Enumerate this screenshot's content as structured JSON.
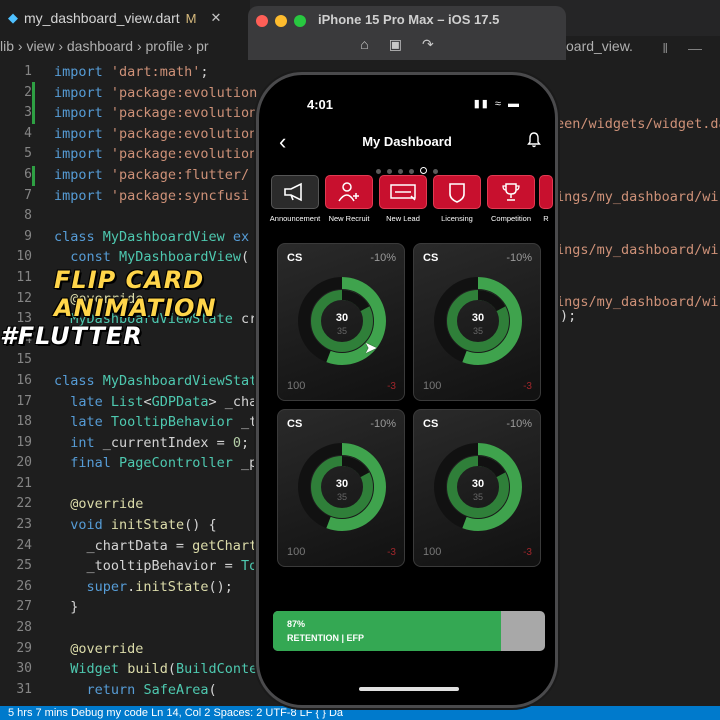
{
  "editor": {
    "tab_label": "my_dashboard_view.dart",
    "tab_modified": "M",
    "breadcrumb": "lib  ›  view  ›  dashboard  ›  profile  ›  pr",
    "breadcrumb_right": "oard_view.",
    "line_numbers": [
      "1",
      "2",
      "3",
      "4",
      "5",
      "6",
      "7",
      "8",
      "9",
      "10",
      "11",
      "12",
      "13",
      "14",
      "15",
      "16",
      "17",
      "18",
      "19",
      "20",
      "21",
      "22",
      "23",
      "24",
      "25",
      "26",
      "27",
      "28",
      "29",
      "30",
      "31"
    ],
    "right_code": [
      "een/widgets/widget.da",
      "ings/my_dashboard/wi",
      "ings/my_dashboard/wi",
      "ings/my_dashboard/wi"
    ],
    "status_text": "5 hrs 7 mins    Debug my code                                                         Ln 14, Col 2   Spaces: 2   UTF-8   LF   { } Da"
  },
  "overlay": {
    "line1": "FLIP CARD",
    "line2": "ANIMATION",
    "line3": "#FLUTTER"
  },
  "simulator": {
    "title": "iPhone 15 Pro Max – iOS 17.5"
  },
  "phone": {
    "time": "4:01",
    "title": "My Dashboard",
    "actions": [
      {
        "label": "Announcement",
        "icon": "megaphone-icon"
      },
      {
        "label": "New Recruit",
        "icon": "add-person-icon"
      },
      {
        "label": "New Lead",
        "icon": "lead-icon"
      },
      {
        "label": "Licensing",
        "icon": "shield-icon"
      },
      {
        "label": "Competition",
        "icon": "trophy-icon"
      },
      {
        "label": "R",
        "icon": "partial-icon"
      }
    ],
    "cards": [
      {
        "title": "CS",
        "change": "-10%",
        "value": "30",
        "sub": "35",
        "min": "100",
        "delta": "-3"
      },
      {
        "title": "CS",
        "change": "-10%",
        "value": "30",
        "sub": "35",
        "min": "100",
        "delta": "-3"
      },
      {
        "title": "CS",
        "change": "-10%",
        "value": "30",
        "sub": "35",
        "min": "100",
        "delta": "-3"
      },
      {
        "title": "CS",
        "change": "-10%",
        "value": "30",
        "sub": "35",
        "min": "100",
        "delta": "-3"
      }
    ],
    "retention": {
      "percent_label": "87%",
      "label": "RETENTION | EFP",
      "fraction": 0.84
    }
  },
  "colors": {
    "accent_red": "#c8102e",
    "ring_green": "#3fa34d",
    "retention_green": "#34a853"
  }
}
